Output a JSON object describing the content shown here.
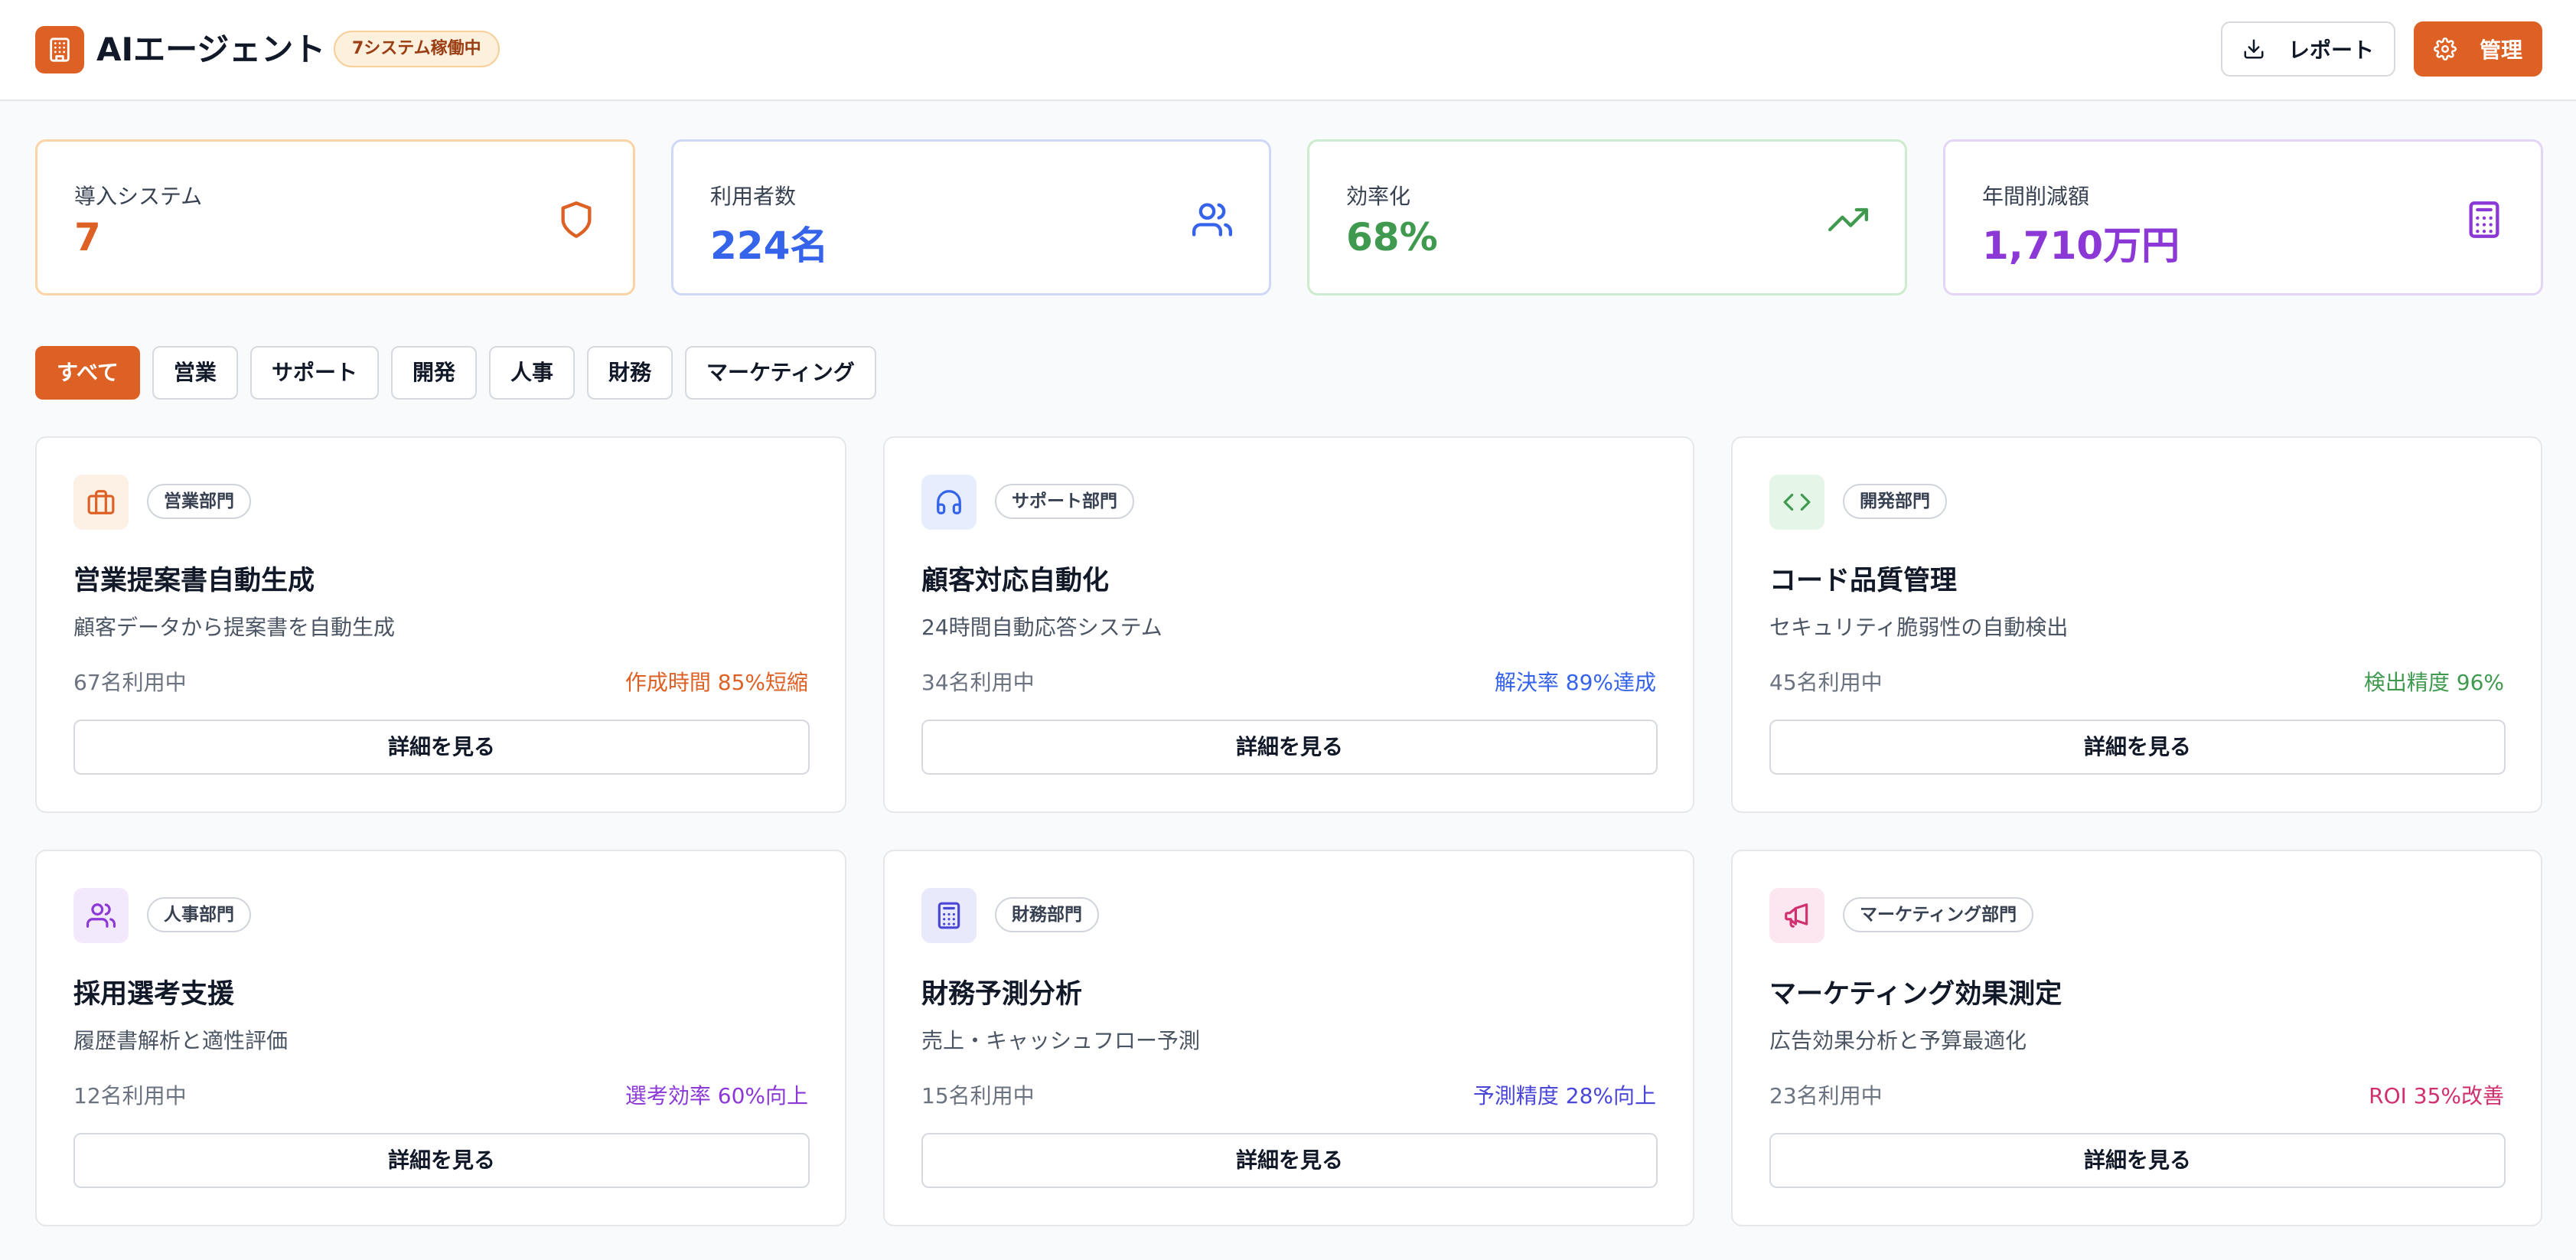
{
  "header": {
    "title": "AIエージェント",
    "status_badge": "7システム稼働中",
    "report_label": "レポート",
    "admin_label": "管理"
  },
  "stats": [
    {
      "label": "導入システム",
      "value": "7",
      "color": "#dd6125",
      "border": "#fbd3a4",
      "icon": "shield-icon"
    },
    {
      "label": "利用者数",
      "value": "224名",
      "color": "#3563e9",
      "border": "#cfd9f7",
      "icon": "users-icon"
    },
    {
      "label": "効率化",
      "value": "68%",
      "color": "#3f9a4f",
      "border": "#cdeccf",
      "icon": "trending-up-icon"
    },
    {
      "label": "年間削減額",
      "value": "1,710万円",
      "color": "#8b38d6",
      "border": "#e4d5f6",
      "icon": "calculator-icon"
    }
  ],
  "filters": [
    "すべて",
    "営業",
    "サポート",
    "開発",
    "人事",
    "財務",
    "マーケティング"
  ],
  "active_filter": "すべて",
  "agents": [
    {
      "dept": "営業部門",
      "title": "営業提案書自動生成",
      "desc": "顧客データから提案書を自動生成",
      "users": "67名利用中",
      "metric": "作成時間 85%短縮",
      "color": "#dd6125",
      "icon_bg": "#fdf0e4",
      "icon": "briefcase-icon",
      "button": "詳細を見る"
    },
    {
      "dept": "サポート部門",
      "title": "顧客対応自動化",
      "desc": "24時間自動応答システム",
      "users": "34名利用中",
      "metric": "解決率 89%達成",
      "color": "#3563e9",
      "icon_bg": "#e6edfc",
      "icon": "headphones-icon",
      "button": "詳細を見る"
    },
    {
      "dept": "開発部門",
      "title": "コード品質管理",
      "desc": "セキュリティ脆弱性の自動検出",
      "users": "45名利用中",
      "metric": "検出精度 96%",
      "color": "#3f9a4f",
      "icon_bg": "#e5f6e8",
      "icon": "code-icon",
      "button": "詳細を見る"
    },
    {
      "dept": "人事部門",
      "title": "採用選考支援",
      "desc": "履歴書解析と適性評価",
      "users": "12名利用中",
      "metric": "選考効率 60%向上",
      "color": "#8b38d6",
      "icon_bg": "#f3e9fc",
      "icon": "users-icon",
      "button": "詳細を見る"
    },
    {
      "dept": "財務部門",
      "title": "財務予測分析",
      "desc": "売上・キャッシュフロー予測",
      "users": "15名利用中",
      "metric": "予測精度 28%向上",
      "color": "#4a46d8",
      "icon_bg": "#e8e9fb",
      "icon": "calculator-icon",
      "button": "詳細を見る"
    },
    {
      "dept": "マーケティング部門",
      "title": "マーケティング効果測定",
      "desc": "広告効果分析と予算最適化",
      "users": "23名利用中",
      "metric": "ROI 35%改善",
      "color": "#d0306f",
      "icon_bg": "#fce7f0",
      "icon": "megaphone-icon",
      "button": "詳細を見る"
    }
  ]
}
